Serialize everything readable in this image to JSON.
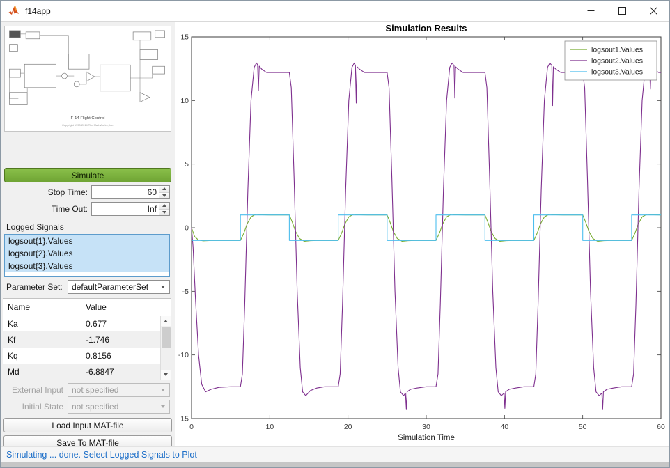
{
  "window": {
    "title": "f14app",
    "controls": [
      "minimize",
      "maximize",
      "close"
    ]
  },
  "left_panel": {
    "model_caption": "F-14 Flight Control",
    "model_copyright": "Copyright 1990-2014 The MathWorks, Inc.",
    "simulate_button": "Simulate",
    "stop_time": {
      "label": "Stop Time:",
      "value": "60"
    },
    "time_out": {
      "label": "Time Out:",
      "value": "Inf"
    },
    "logged_signals": {
      "label": "Logged Signals",
      "items": [
        "logsout{1}.Values",
        "logsout{2}.Values",
        "logsout{3}.Values"
      ]
    },
    "parameter_set": {
      "label": "Parameter Set:",
      "value": "defaultParameterSet"
    },
    "param_table": {
      "headers": [
        "Name",
        "Value"
      ],
      "rows": [
        [
          "Ka",
          "0.677"
        ],
        [
          "Kf",
          "-1.746"
        ],
        [
          "Kq",
          "0.8156"
        ],
        [
          "Md",
          "-6.8847"
        ]
      ]
    },
    "external_input": {
      "label": "External Input",
      "value": "not specified"
    },
    "initial_state": {
      "label": "Initial State",
      "value": "not specified"
    },
    "load_button": "Load Input MAT-file",
    "save_button": "Save To MAT-file"
  },
  "status_bar": {
    "text": "Simulating ... done. Select Logged Signals to Plot",
    "color": "#1c6ec8"
  },
  "chart_data": {
    "type": "line",
    "title": "Simulation Results",
    "xlabel": "Simulation Time",
    "ylabel": "",
    "xlim": [
      0,
      60
    ],
    "ylim": [
      -15,
      15
    ],
    "xticks": [
      0,
      10,
      20,
      30,
      40,
      50,
      60
    ],
    "yticks": [
      -15,
      -10,
      -5,
      0,
      5,
      10,
      15
    ],
    "grid": false,
    "legend_position": "top-right",
    "series": [
      {
        "name": "logsout1.Values",
        "color": "#77AC30",
        "points": [
          [
            0,
            0
          ],
          [
            0.4,
            -0.7
          ],
          [
            0.9,
            -0.97
          ],
          [
            1.5,
            -1.03
          ],
          [
            2.5,
            -1
          ],
          [
            6.25,
            -1
          ],
          [
            6.7,
            -0.4
          ],
          [
            7.1,
            0.3
          ],
          [
            7.6,
            0.85
          ],
          [
            8.2,
            1.06
          ],
          [
            9,
            1.02
          ],
          [
            10,
            1
          ],
          [
            12.5,
            1
          ],
          [
            12.9,
            0.4
          ],
          [
            13.3,
            -0.3
          ],
          [
            13.8,
            -0.85
          ],
          [
            14.4,
            -1.06
          ],
          [
            15.2,
            -1.02
          ],
          [
            16,
            -1
          ],
          [
            18.75,
            -1
          ],
          [
            19.2,
            -0.4
          ],
          [
            19.6,
            0.3
          ],
          [
            20.1,
            0.85
          ],
          [
            20.7,
            1.06
          ],
          [
            21.5,
            1.02
          ],
          [
            22.5,
            1
          ],
          [
            25,
            1
          ],
          [
            25.4,
            0.4
          ],
          [
            25.8,
            -0.3
          ],
          [
            26.3,
            -0.85
          ],
          [
            26.9,
            -1.06
          ],
          [
            27.7,
            -1.02
          ],
          [
            28.5,
            -1
          ],
          [
            31.25,
            -1
          ],
          [
            31.7,
            -0.4
          ],
          [
            32.1,
            0.3
          ],
          [
            32.6,
            0.85
          ],
          [
            33.2,
            1.06
          ],
          [
            34,
            1.02
          ],
          [
            35,
            1
          ],
          [
            37.5,
            1
          ],
          [
            37.9,
            0.4
          ],
          [
            38.3,
            -0.3
          ],
          [
            38.8,
            -0.85
          ],
          [
            39.4,
            -1.06
          ],
          [
            40.2,
            -1.02
          ],
          [
            41,
            -1
          ],
          [
            43.75,
            -1
          ],
          [
            44.2,
            -0.4
          ],
          [
            44.6,
            0.3
          ],
          [
            45.1,
            0.85
          ],
          [
            45.7,
            1.06
          ],
          [
            46.5,
            1.02
          ],
          [
            47.5,
            1
          ],
          [
            50,
            1
          ],
          [
            50.4,
            0.4
          ],
          [
            50.8,
            -0.3
          ],
          [
            51.3,
            -0.85
          ],
          [
            51.9,
            -1.06
          ],
          [
            52.7,
            -1.02
          ],
          [
            53.5,
            -1
          ],
          [
            56.25,
            -1
          ],
          [
            56.7,
            -0.4
          ],
          [
            57.1,
            0.3
          ],
          [
            57.6,
            0.85
          ],
          [
            58.2,
            1.06
          ],
          [
            59,
            1.02
          ],
          [
            60,
            1
          ]
        ]
      },
      {
        "name": "logsout2.Values",
        "color": "#7E2F8E",
        "points": [
          [
            0,
            0
          ],
          [
            0.2,
            -1.5
          ],
          [
            0.5,
            -5.5
          ],
          [
            0.9,
            -10
          ],
          [
            1.3,
            -12.3
          ],
          [
            1.8,
            -12.9
          ],
          [
            2.5,
            -12.7
          ],
          [
            3.5,
            -12.55
          ],
          [
            5,
            -12.5
          ],
          [
            6.25,
            -12.5
          ],
          [
            6.5,
            -11.5
          ],
          [
            6.8,
            -6
          ],
          [
            7.2,
            3
          ],
          [
            7.6,
            10
          ],
          [
            8,
            12.6
          ],
          [
            8.3,
            12.95
          ],
          [
            8.45,
            12.8
          ],
          [
            8.55,
            10.8
          ],
          [
            8.65,
            12.7
          ],
          [
            9,
            12.45
          ],
          [
            9.6,
            12.2
          ],
          [
            10.5,
            12.2
          ],
          [
            11.5,
            12.2
          ],
          [
            12.5,
            12.2
          ],
          [
            12.75,
            11
          ],
          [
            13.1,
            4
          ],
          [
            13.5,
            -5
          ],
          [
            13.9,
            -11
          ],
          [
            14.2,
            -12.9
          ],
          [
            14.6,
            -13.2
          ],
          [
            15.2,
            -12.8
          ],
          [
            16,
            -12.6
          ],
          [
            17,
            -12.5
          ],
          [
            18.75,
            -12.5
          ],
          [
            19,
            -11.5
          ],
          [
            19.3,
            -6
          ],
          [
            19.7,
            3
          ],
          [
            20.1,
            10
          ],
          [
            20.5,
            12.6
          ],
          [
            20.8,
            12.95
          ],
          [
            20.95,
            12.75
          ],
          [
            21.05,
            9.8
          ],
          [
            21.15,
            12.65
          ],
          [
            21.5,
            12.45
          ],
          [
            22.1,
            12.2
          ],
          [
            23,
            12.2
          ],
          [
            24,
            12.2
          ],
          [
            25,
            12.2
          ],
          [
            25.25,
            11
          ],
          [
            25.6,
            4
          ],
          [
            26,
            -5
          ],
          [
            26.4,
            -11
          ],
          [
            26.7,
            -12.9
          ],
          [
            27.1,
            -13.2
          ],
          [
            27.35,
            -13
          ],
          [
            27.45,
            -14.3
          ],
          [
            27.55,
            -12.9
          ],
          [
            28,
            -12.7
          ],
          [
            28.8,
            -12.6
          ],
          [
            30,
            -12.5
          ],
          [
            31.25,
            -12.5
          ],
          [
            31.5,
            -11.5
          ],
          [
            31.8,
            -6
          ],
          [
            32.2,
            3
          ],
          [
            32.6,
            10
          ],
          [
            33,
            12.6
          ],
          [
            33.3,
            12.95
          ],
          [
            33.55,
            12.75
          ],
          [
            33.65,
            10.2
          ],
          [
            33.75,
            12.65
          ],
          [
            34.1,
            12.45
          ],
          [
            34.7,
            12.2
          ],
          [
            35.5,
            12.2
          ],
          [
            36.5,
            12.2
          ],
          [
            37.5,
            12.2
          ],
          [
            37.75,
            11
          ],
          [
            38.1,
            4
          ],
          [
            38.5,
            -5
          ],
          [
            38.9,
            -11
          ],
          [
            39.2,
            -12.9
          ],
          [
            39.6,
            -13.2
          ],
          [
            39.95,
            -13
          ],
          [
            40.05,
            -14.2
          ],
          [
            40.15,
            -12.9
          ],
          [
            40.6,
            -12.7
          ],
          [
            41.4,
            -12.6
          ],
          [
            42.5,
            -12.5
          ],
          [
            43.75,
            -12.5
          ],
          [
            44,
            -11.5
          ],
          [
            44.3,
            -6
          ],
          [
            44.7,
            3
          ],
          [
            45.1,
            10
          ],
          [
            45.5,
            12.6
          ],
          [
            45.8,
            12.95
          ],
          [
            46.05,
            12.75
          ],
          [
            46.15,
            9.6
          ],
          [
            46.25,
            12.65
          ],
          [
            46.6,
            12.45
          ],
          [
            47.2,
            12.2
          ],
          [
            48,
            12.2
          ],
          [
            49,
            12.2
          ],
          [
            50,
            12.2
          ],
          [
            50.25,
            11
          ],
          [
            50.6,
            4
          ],
          [
            51,
            -5
          ],
          [
            51.4,
            -11
          ],
          [
            51.7,
            -12.9
          ],
          [
            52.1,
            -13.2
          ],
          [
            52.45,
            -13
          ],
          [
            52.55,
            -14.3
          ],
          [
            52.65,
            -12.9
          ],
          [
            53.1,
            -12.7
          ],
          [
            53.9,
            -12.6
          ],
          [
            55,
            -12.5
          ],
          [
            56.25,
            -12.5
          ],
          [
            56.5,
            -11.5
          ],
          [
            56.8,
            -6
          ],
          [
            57.2,
            3
          ],
          [
            57.6,
            10
          ],
          [
            58,
            12.6
          ],
          [
            58.3,
            12.95
          ],
          [
            58.55,
            12.75
          ],
          [
            58.65,
            10.9
          ],
          [
            58.75,
            12.65
          ],
          [
            59.1,
            12.45
          ],
          [
            59.7,
            12.2
          ],
          [
            60,
            12.2
          ]
        ]
      },
      {
        "name": "logsout3.Values",
        "color": "#4DBEEE",
        "points": [
          [
            0,
            -1
          ],
          [
            6.25,
            -1
          ],
          [
            6.25,
            1
          ],
          [
            12.5,
            1
          ],
          [
            12.5,
            -1
          ],
          [
            18.75,
            -1
          ],
          [
            18.75,
            1
          ],
          [
            25,
            1
          ],
          [
            25,
            -1
          ],
          [
            31.25,
            -1
          ],
          [
            31.25,
            1
          ],
          [
            37.5,
            1
          ],
          [
            37.5,
            -1
          ],
          [
            43.75,
            -1
          ],
          [
            43.75,
            1
          ],
          [
            50,
            1
          ],
          [
            50,
            -1
          ],
          [
            56.25,
            -1
          ],
          [
            56.25,
            1
          ],
          [
            60,
            1
          ]
        ]
      }
    ]
  }
}
